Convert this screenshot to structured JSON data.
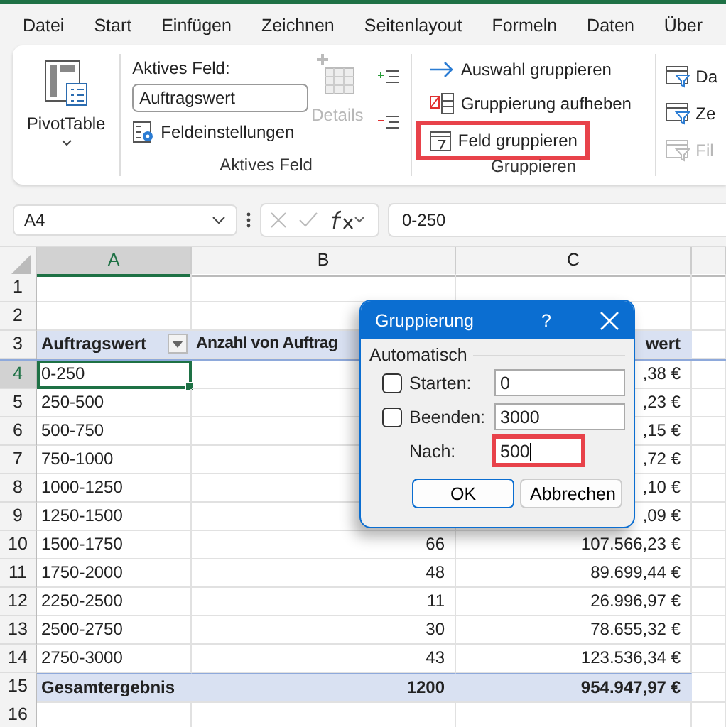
{
  "menu_tabs": [
    "Datei",
    "Start",
    "Einfügen",
    "Zeichnen",
    "Seitenlayout",
    "Formeln",
    "Daten",
    "Über"
  ],
  "ribbon": {
    "pivottable": {
      "label": "PivotTable"
    },
    "active_field": {
      "caption": "Aktives Feld:",
      "value": "Auftragswert",
      "details": {
        "label": "Details",
        "disabled": true
      },
      "settings": "Feldeinstellungen",
      "group_label": "Aktives Feld"
    },
    "group": {
      "buttons": [
        {
          "label": "Auswahl gruppieren",
          "kind": "arrow",
          "highlighted": false
        },
        {
          "label": "Gruppierung aufheben",
          "kind": "ungroup",
          "highlighted": false
        },
        {
          "label": "Feld gruppieren",
          "kind": "calendar",
          "highlighted": true
        }
      ],
      "group_label": "Gruppieren"
    },
    "cut_group": [
      {
        "label": "Da",
        "disabled": false
      },
      {
        "label": "Ze",
        "disabled": false
      },
      {
        "label": "Fil",
        "disabled": true
      }
    ]
  },
  "formula_bar": {
    "name_box": "A4",
    "formula": "0-250"
  },
  "columns": [
    "A",
    "B",
    "C"
  ],
  "rows": [
    {
      "num": "1",
      "kind": "empty"
    },
    {
      "num": "2",
      "kind": "empty"
    },
    {
      "num": "3",
      "kind": "header",
      "a": "Auftragswert",
      "b": "Anzahl von Auftrag",
      "c": "wert"
    },
    {
      "num": "4",
      "kind": "item",
      "a": "0-250",
      "c": ",38 €",
      "selected": true
    },
    {
      "num": "5",
      "kind": "item",
      "a": "250-500",
      "c": ",23 €",
      "selected": false
    },
    {
      "num": "6",
      "kind": "item",
      "a": "500-750",
      "c": ",15 €",
      "selected": false
    },
    {
      "num": "7",
      "kind": "item",
      "a": "750-1000",
      "c": ",72 €",
      "selected": false
    },
    {
      "num": "8",
      "kind": "item",
      "a": "1000-1250",
      "c": ",10 €",
      "selected": false
    },
    {
      "num": "9",
      "kind": "item",
      "a": "1250-1500",
      "c": ",09 €",
      "selected": false
    },
    {
      "num": "10",
      "kind": "item",
      "a": "1500-1750",
      "b": "66",
      "c": "107.566,23 €",
      "selected": false
    },
    {
      "num": "11",
      "kind": "item",
      "a": "1750-2000",
      "b": "48",
      "c": "89.699,44 €",
      "selected": false
    },
    {
      "num": "12",
      "kind": "item",
      "a": "2250-2500",
      "b": "11",
      "c": "26.996,97 €",
      "selected": false
    },
    {
      "num": "13",
      "kind": "item",
      "a": "2500-2750",
      "b": "30",
      "c": "78.655,32 €",
      "selected": false
    },
    {
      "num": "14",
      "kind": "item",
      "a": "2750-3000",
      "b": "43",
      "c": "123.536,34 €",
      "selected": false
    },
    {
      "num": "15",
      "kind": "total",
      "a": "Gesamtergebnis",
      "b": "1200",
      "c": "954.947,97 €"
    },
    {
      "num": "16",
      "kind": "empty"
    }
  ],
  "dialog": {
    "title": "Gruppierung",
    "help": "?",
    "section": "Automatisch",
    "fields": [
      {
        "label": "Starten:",
        "value": "0",
        "kind": "checkbox",
        "checked": false,
        "highlighted": false
      },
      {
        "label": "Beenden:",
        "value": "3000",
        "kind": "checkbox",
        "checked": false,
        "highlighted": false
      },
      {
        "label": "Nach:",
        "value": "500",
        "kind": "plain",
        "highlighted": true
      }
    ],
    "buttons": [
      {
        "label": "OK",
        "default": true
      },
      {
        "label": "Abbrechen",
        "default": false
      }
    ]
  }
}
